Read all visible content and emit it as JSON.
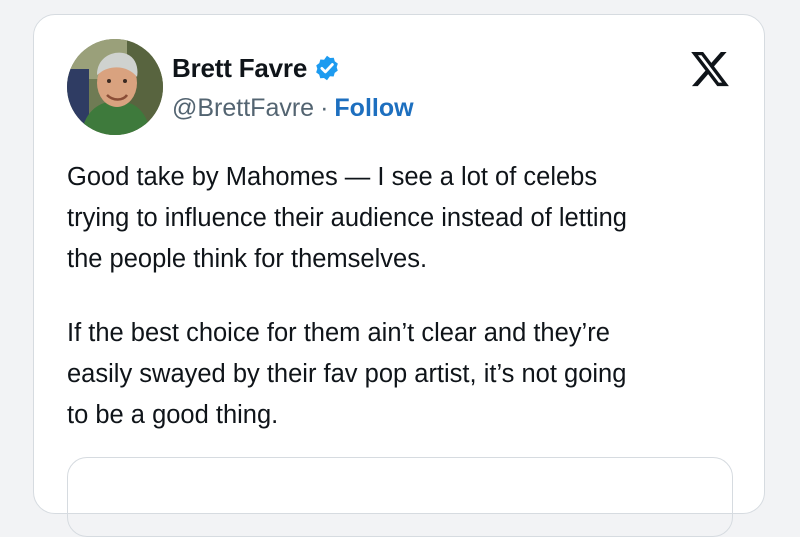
{
  "tweet": {
    "author": {
      "display_name": "Brett Favre",
      "handle": "@BrettFavre",
      "verified": true,
      "verified_icon": "verified-badge-icon",
      "separator": "·",
      "follow_label": "Follow"
    },
    "brand_icon": "x-logo-icon",
    "paragraphs": [
      "Good take by Mahomes — I see a lot of celebs\ntrying to influence their audience instead of letting\nthe people think for themselves.",
      "If the best choice for them ain’t clear and they’re\neasily swayed by their fav pop artist, it’s not going\nto be a good thing."
    ]
  },
  "colors": {
    "text": "#0f1419",
    "muted": "#536471",
    "link": "#1d6fbf",
    "verified": "#1d9bf0",
    "border": "#d6dbe0"
  }
}
